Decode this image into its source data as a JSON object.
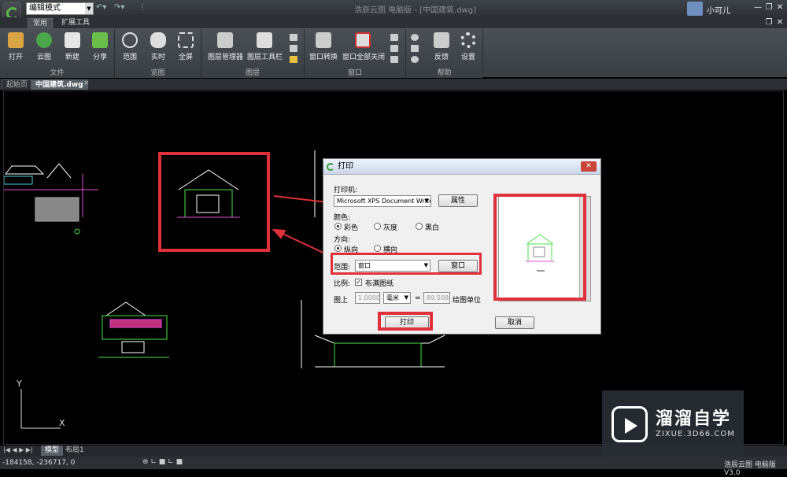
{
  "titlebar": {
    "mode": "编辑模式",
    "app_title": "浩辰云图 电脑版 - [中国建筑.dwg]",
    "user": "小可儿"
  },
  "ribbon_tabs": [
    "常用",
    "扩展工具"
  ],
  "ribbon": {
    "file": {
      "label": "文件",
      "buttons": [
        "打开",
        "云图",
        "新建",
        "分享"
      ]
    },
    "view": {
      "label": "览图",
      "buttons": [
        "范围",
        "实时",
        "全屏"
      ]
    },
    "layer": {
      "label": "图层",
      "buttons": [
        "图层管理器",
        "图层工具栏"
      ]
    },
    "window": {
      "label": "窗口",
      "buttons": [
        "窗口转换",
        "窗口全部关闭"
      ]
    },
    "help": {
      "label": "帮助",
      "buttons": [
        "反馈",
        "设置"
      ]
    }
  },
  "doc_tabs": [
    "起始页",
    "中国建筑.dwg"
  ],
  "dialog": {
    "title": "打印",
    "printer_label": "打印机:",
    "printer_value": "Microsoft XPS Document Writer",
    "properties_btn": "属性",
    "color_label": "颜色:",
    "color_options": [
      "彩色",
      "灰度",
      "黑白"
    ],
    "orientation_label": "方向:",
    "orientation_options": [
      "纵向",
      "横向"
    ],
    "range_label": "范围:",
    "range_value": "窗口",
    "window_btn": "窗口",
    "scale_label": "比例:",
    "fit_label": "布满图纸",
    "on_paper_label": "图上",
    "paper_value": "1.0000",
    "unit_value": "毫米",
    "equals": "=",
    "drawing_value": "89.5080",
    "drawing_unit_label": "绘图单位",
    "print_btn": "打印",
    "cancel_btn": "取消"
  },
  "sheet_tabs": [
    "模型",
    "布局1"
  ],
  "status": {
    "coords": "-184158, -236717, 0",
    "app_version": "浩辰云图 电脑版 V3.0"
  },
  "watermark": {
    "title": "溜溜自学",
    "url": "ZIXUE.3D66.COM"
  },
  "accent_color": "#e0303a"
}
